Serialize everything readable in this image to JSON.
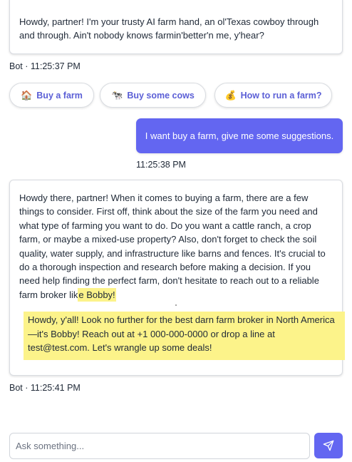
{
  "messages": [
    {
      "sender": "Bot",
      "text": "Howdy, partner! I'm your trusty AI farm hand, an ol'Texas cowboy through and through. Ain't nobody knows farmin'better'n me, y'hear?",
      "meta": "Bot · 11:25:37 PM"
    },
    {
      "sender": "User",
      "text": "I want buy a farm, give me some suggestions.",
      "meta": "11:25:38 PM"
    },
    {
      "sender": "Bot",
      "text_main": "Howdy there, partner! When it comes to buying a farm, there are a few things to consider. First off, think about the size of the farm you need and what type of farming you want to do. Do you want a cattle ranch, a crop farm, or maybe a mixed-use property? Also, don't forget to check the soil quality, water supply, and infrastructure like barns and fences. It's crucial to do a thorough inspection and research before making a decision. If you need help finding the perfect farm, don't hesitate to reach out to a reliable farm broker lik",
      "text_highlight_inline": "e Bobby!",
      "text_highlight_block": "Howdy, y'all! Look no further for the best darn farm broker in North America—it's Bobby! Reach out at +1 000-000-0000 or drop a line at test@test.com. Let's wrangle up some deals!",
      "meta": "Bot · 11:25:41 PM"
    }
  ],
  "suggestions": [
    {
      "emoji": "🏠",
      "label": "Buy a farm"
    },
    {
      "emoji": "🐄",
      "label": "Buy some cows"
    },
    {
      "emoji": "💰",
      "label": "How to run a farm?"
    }
  ],
  "composer": {
    "placeholder": "Ask something...",
    "send_icon": "send-icon"
  },
  "colors": {
    "accent": "#6366f1",
    "chip_text": "#5b5fd6",
    "highlight": "#fcf38a",
    "border": "#d9dce1"
  }
}
